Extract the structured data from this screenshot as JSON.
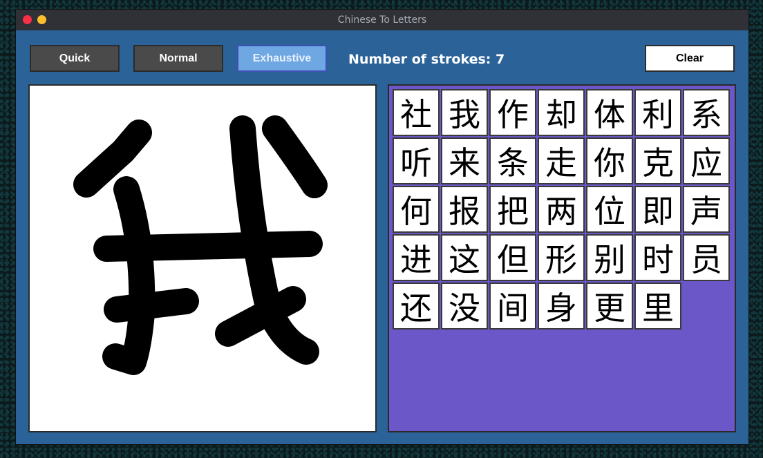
{
  "window": {
    "title": "Chinese To Letters"
  },
  "toolbar": {
    "quick_label": "Quick",
    "normal_label": "Normal",
    "exhaustive_label": "Exhaustive",
    "clear_label": "Clear",
    "strokes_text": "Number of strokes: 7",
    "selected_mode": "Exhaustive"
  },
  "colors": {
    "window_bg": "#2b6399",
    "results_bg": "#6b57c7",
    "selected_button": "#6fa7e2"
  },
  "results": {
    "characters": [
      "社",
      "我",
      "作",
      "却",
      "体",
      "利",
      "系",
      "听",
      "来",
      "条",
      "走",
      "你",
      "克",
      "应",
      "何",
      "报",
      "把",
      "两",
      "位",
      "即",
      "声",
      "进",
      "这",
      "但",
      "形",
      "别",
      "时",
      "员",
      "还",
      "没",
      "间",
      "身",
      "更",
      "里"
    ]
  }
}
